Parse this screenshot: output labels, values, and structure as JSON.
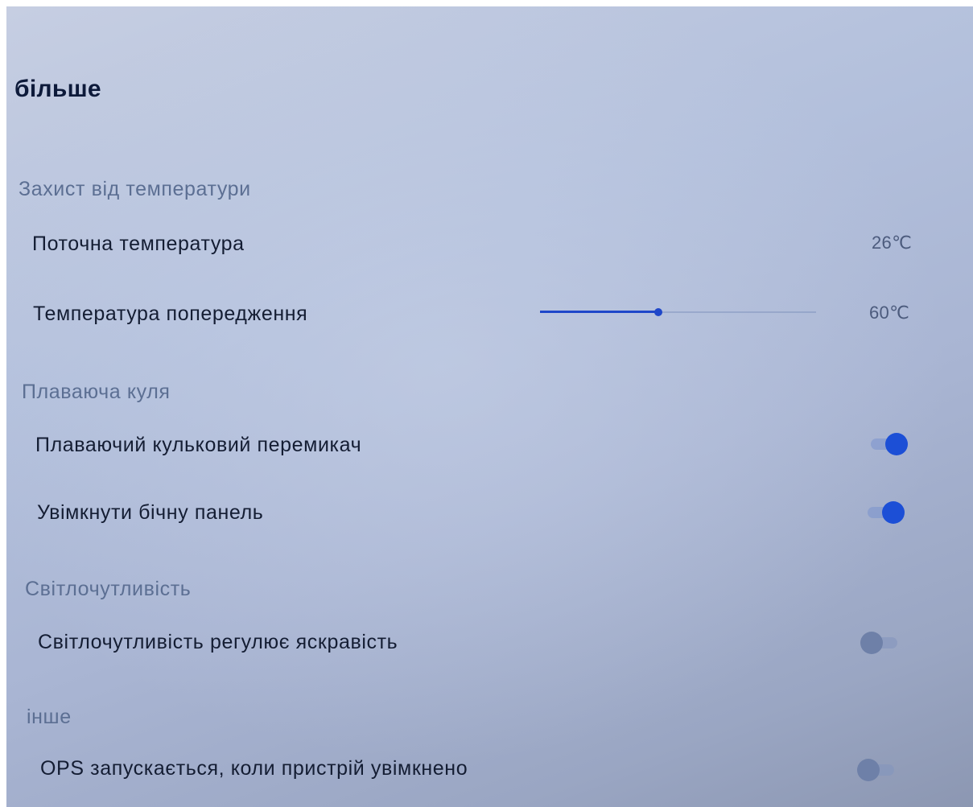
{
  "page": {
    "title": "більше"
  },
  "sections": {
    "temperature": {
      "header": "Захист від температури",
      "current_label": "Поточна температура",
      "current_value": "26℃",
      "warning_label": "Температура попередження",
      "warning_value": "60℃",
      "warning_slider_fraction": 0.43
    },
    "floating_ball": {
      "header": "Плаваюча куля",
      "switch_label": "Плаваючий кульковий перемикач",
      "switch_on": true,
      "sidebar_label": "Увімкнути бічну панель",
      "sidebar_on": true
    },
    "light_sensitivity": {
      "header": "Світлочутливість",
      "brightness_label": "Світлочутливість регулює яскравість",
      "brightness_on": false
    },
    "other": {
      "header": "інше",
      "ops_label": "OPS запускається, коли пристрій увімкнено",
      "ops_on": false
    }
  },
  "colors": {
    "accent": "#1c4fd6",
    "toggle_off": "#6e80a8",
    "section_header": "#5c6f93",
    "text": "#141d33"
  }
}
